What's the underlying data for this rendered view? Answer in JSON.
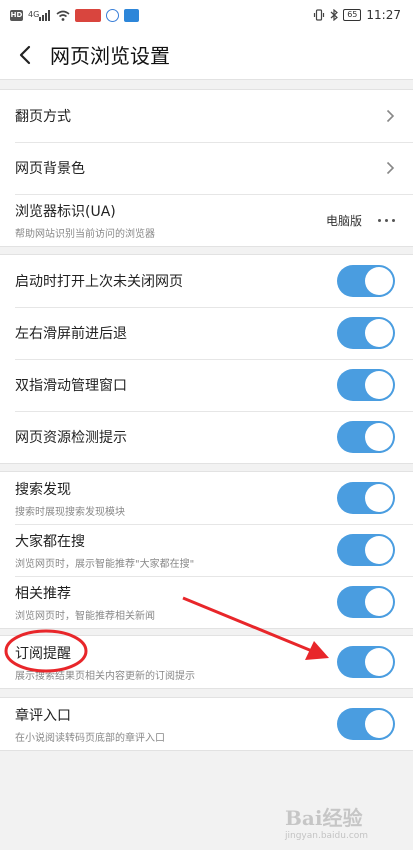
{
  "status_bar": {
    "left_icons": [
      "hd-icon",
      "signal-4g-icon",
      "wifi-icon",
      "red-app-icon",
      "circle-app-icon",
      "blue-app-icon"
    ],
    "hd_label": "HD",
    "network_label": "4G",
    "battery": "65",
    "time": "11:27"
  },
  "header": {
    "title": "网页浏览设置"
  },
  "group1": {
    "items": [
      {
        "title": "翻页方式"
      },
      {
        "title": "网页背景色"
      },
      {
        "title": "浏览器标识(UA)",
        "subtitle": "帮助网站识别当前访问的浏览器",
        "value": "电脑版"
      }
    ]
  },
  "group2": {
    "items": [
      {
        "title": "启动时打开上次未关闭网页",
        "enabled": true
      },
      {
        "title": "左右滑屏前进后退",
        "enabled": true
      },
      {
        "title": "双指滑动管理窗口",
        "enabled": true
      },
      {
        "title": "网页资源检测提示",
        "enabled": true
      }
    ]
  },
  "group3": {
    "items": [
      {
        "title": "搜索发现",
        "subtitle": "搜索时展现搜索发现模块",
        "enabled": true
      },
      {
        "title": "大家都在搜",
        "subtitle": "浏览网页时，展示智能推荐\"大家都在搜\"",
        "enabled": true
      },
      {
        "title": "相关推荐",
        "subtitle": "浏览网页时，智能推荐相关新闻",
        "enabled": true
      }
    ]
  },
  "group4": {
    "items": [
      {
        "title": "订阅提醒",
        "subtitle": "展示搜索结果页相关内容更新的订阅提示",
        "enabled": true
      }
    ]
  },
  "group5": {
    "items": [
      {
        "title": "章评入口",
        "subtitle": "在小说阅读转码页底部的章评入口",
        "enabled": true
      }
    ]
  },
  "colors": {
    "toggle_on": "#4a9de0",
    "annotation_red": "#e8262a",
    "background": "#f2f2f2"
  },
  "watermark": {
    "text": "Bai经验",
    "sub": "jingyan.baidu.com"
  }
}
